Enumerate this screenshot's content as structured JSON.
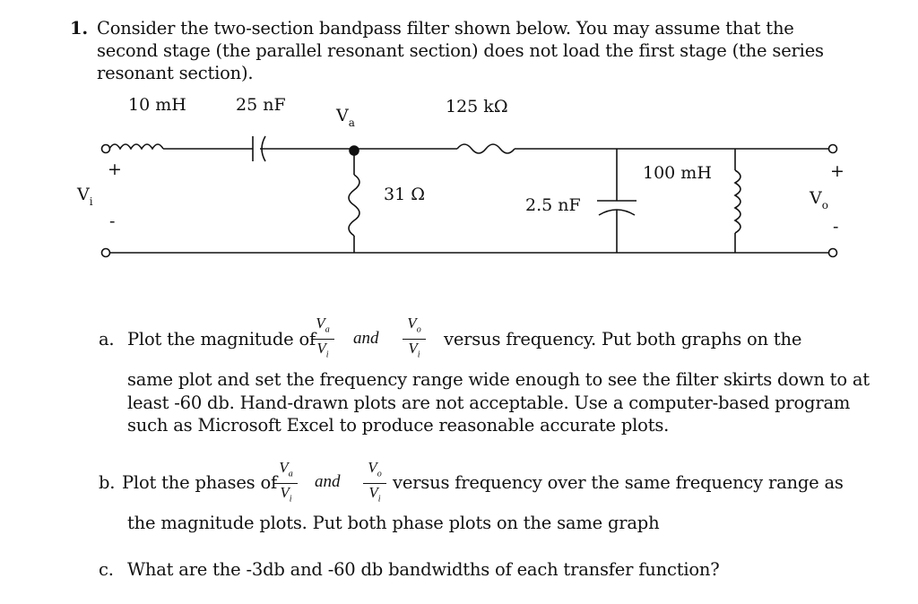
{
  "problem": {
    "number": "1.",
    "intro_lines": [
      "Consider the two-section bandpass filter shown below. You may assume that the",
      "second stage (the parallel resonant section) does not load the first stage (the series",
      "resonant section)."
    ]
  },
  "circuit": {
    "inductor1": "10 mH",
    "capacitor1": "25 nF",
    "node_label": "V",
    "node_sub": "a",
    "resistor_series": "125 kΩ",
    "resistor_shunt": "31 Ω",
    "capacitor2": "2.5 nF",
    "inductor2": "100 mH",
    "input_label": "V",
    "input_sub": "i",
    "output_label": "V",
    "output_sub": "o",
    "plus": "+",
    "minus": "-"
  },
  "parts": {
    "a": {
      "marker": "a.",
      "lead": "Plot the magnitude of",
      "frac1_num": "V",
      "frac1_num_sub": "a",
      "frac1_den": "V",
      "frac1_den_sub": "i",
      "and": "and",
      "frac2_num": "V",
      "frac2_num_sub": "o",
      "frac2_den": "V",
      "frac2_den_sub": "i",
      "tail": "versus frequency. Put both graphs on the",
      "lines": [
        "same plot and set the frequency range wide enough to see the filter skirts down to at",
        "least -60 db. Hand-drawn plots are not acceptable. Use a computer-based program",
        "such as Microsoft Excel to produce reasonable accurate plots."
      ]
    },
    "b": {
      "marker": "b.",
      "lead": "Plot the phases of",
      "frac1_num": "V",
      "frac1_num_sub": "a",
      "frac1_den": "V",
      "frac1_den_sub": "i",
      "and": "and",
      "frac2_num": "V",
      "frac2_num_sub": "o",
      "frac2_den": "V",
      "frac2_den_sub": "i",
      "tail": "versus frequency over the same frequency range as",
      "line2": "the magnitude plots. Put both phase plots on the same graph"
    },
    "c": {
      "marker": "c.",
      "text": "What are the -3db and -60 db bandwidths of each transfer function?"
    }
  }
}
